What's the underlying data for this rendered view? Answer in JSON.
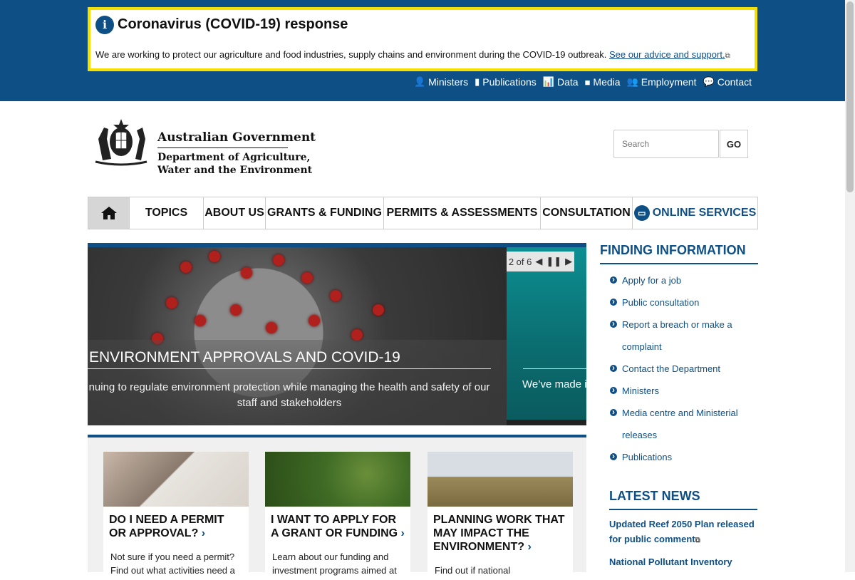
{
  "covid_banner": {
    "info_icon": "info-icon",
    "title": "Coronavirus (COVID-19) response",
    "body": "We are working to protect our agriculture and food industries, supply chains and environment during the COVID-19 outbreak.",
    "link": "See our advice and support."
  },
  "utility_nav": [
    {
      "label": "Ministers",
      "icon": "user-icon"
    },
    {
      "label": "Publications",
      "icon": "book-icon"
    },
    {
      "label": "Data",
      "icon": "bar-chart-icon"
    },
    {
      "label": "Media",
      "icon": "video-camera-icon"
    },
    {
      "label": "Employment",
      "icon": "users-icon"
    },
    {
      "label": "Contact",
      "icon": "speech-bubble-icon"
    }
  ],
  "logo": {
    "line1": "Australian Government",
    "line2": "Department of Agriculture,",
    "line3": "Water and the Environment"
  },
  "search": {
    "placeholder": "Search",
    "button": "GO"
  },
  "main_nav": [
    "TOPICS",
    "ABOUT US",
    "GRANTS & FUNDING",
    "PERMITS & ASSESSMENTS",
    "CONSULTATION",
    "ONLINE SERVICES"
  ],
  "slider": {
    "counter": "2 of 6",
    "slide_title": "ENVIRONMENT APPROVALS AND COVID-19",
    "slide_text": "nuing to regulate environment protection while managing the health and safety of our staff and stakeholders",
    "next_slide_text": "We’ve made i"
  },
  "cards": [
    {
      "title": "DO I NEED A PERMIT OR APPROVAL?",
      "text": "Not sure if you need a permit? Find out what activities need a"
    },
    {
      "title": "I WANT TO APPLY FOR A GRANT OR FUNDING",
      "text": "Learn about our funding and investment programs aimed at"
    },
    {
      "title": "PLANNING WORK THAT MAY IMPACT THE ENVIRONMENT?",
      "text": "Find out if national"
    }
  ],
  "finding_information": {
    "heading": "FINDING INFORMATION",
    "links": [
      "Apply for a job",
      "Public consultation",
      "Report a breach or make a complaint",
      "Contact the Department",
      "Ministers",
      "Media centre and Ministerial releases",
      "Publications"
    ]
  },
  "latest_news": {
    "heading": "LATEST NEWS",
    "items": [
      "Updated Reef 2050 Plan released for public comment",
      "National Pollutant Inventory"
    ]
  },
  "colors": {
    "brand": "#0e4f85",
    "banner_border": "#f5e000",
    "teal": "#0d8f92"
  }
}
